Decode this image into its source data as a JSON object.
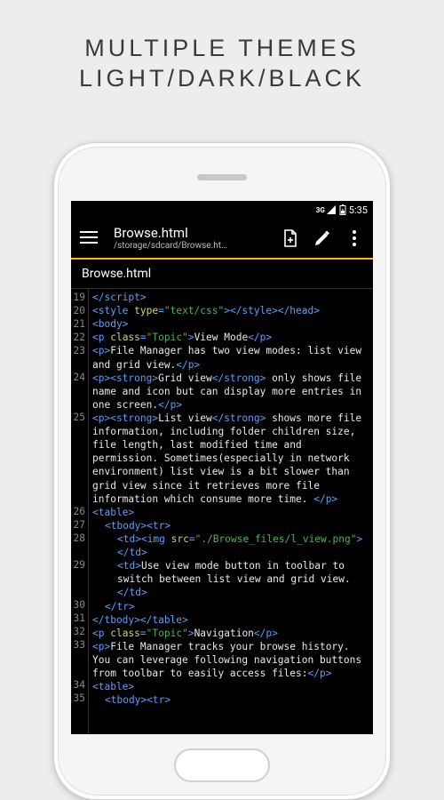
{
  "heading_line1": "MULTIPLE THEMES",
  "heading_line2": "LIGHT/DARK/BLACK",
  "status": {
    "net": "3G",
    "time": "5:35"
  },
  "appbar": {
    "title": "Browse.html",
    "subtitle": "/storage/sdcard/Browse.ht…"
  },
  "tab": "Browse.html",
  "lines": [
    {
      "n": "19",
      "seg": [
        [
          "tag",
          "</script>"
        ]
      ]
    },
    {
      "n": "20",
      "seg": [
        [
          "tag",
          "<style "
        ],
        [
          "attr",
          "type"
        ],
        [
          "tag",
          "="
        ],
        [
          "str",
          "\"text/css\""
        ],
        [
          "tag",
          "></style></head>"
        ]
      ]
    },
    {
      "n": "21",
      "seg": [
        [
          "tag",
          "<body>"
        ]
      ]
    },
    {
      "n": "22",
      "seg": [
        [
          "tag",
          "<p "
        ],
        [
          "attr",
          "class"
        ],
        [
          "tag",
          "="
        ],
        [
          "str",
          "\"Topic\""
        ],
        [
          "tag",
          ">"
        ],
        [
          "txt",
          "View Mode"
        ],
        [
          "tag",
          "</p>"
        ]
      ]
    },
    {
      "n": "23",
      "seg": [
        [
          "tag",
          "<p>"
        ],
        [
          "txt",
          "File Manager has two view modes: list view and grid view."
        ],
        [
          "tag",
          "</p>"
        ]
      ]
    },
    {
      "n": "24",
      "seg": [
        [
          "tag",
          "<p><strong>"
        ],
        [
          "txt",
          "Grid view"
        ],
        [
          "tag",
          "</strong>"
        ],
        [
          "txt",
          " only shows  file name and icon but can display more entries in one screen."
        ],
        [
          "tag",
          "</p>"
        ]
      ]
    },
    {
      "n": "25",
      "seg": [
        [
          "tag",
          "<p><strong>"
        ],
        [
          "txt",
          "List view"
        ],
        [
          "tag",
          "</strong>"
        ],
        [
          "txt",
          " shows more file information, including folder children size, file length, last modified time and permission. Sometimes(especially in network environment) list view is a bit slower than grid view since it retrieves more file information which consume more time. "
        ],
        [
          "tag",
          "</p>"
        ]
      ]
    },
    {
      "n": "26",
      "seg": [
        [
          "tag",
          "<table>"
        ]
      ]
    },
    {
      "n": "27",
      "indent": 1,
      "seg": [
        [
          "tag",
          "<tbody><tr>"
        ]
      ]
    },
    {
      "n": "28",
      "indent": 2,
      "seg": [
        [
          "tag",
          "<td><img "
        ],
        [
          "attr",
          "src"
        ],
        [
          "tag",
          "="
        ],
        [
          "str",
          "\"./Browse_files/l_view.png\""
        ],
        [
          "tag",
          "></td>"
        ]
      ]
    },
    {
      "n": "29",
      "indent": 2,
      "seg": [
        [
          "tag",
          "<td>"
        ],
        [
          "txt",
          "Use view mode button in toolbar to switch between list view and grid view."
        ],
        [
          "tag",
          "</td>"
        ]
      ]
    },
    {
      "n": "30",
      "indent": 1,
      "seg": [
        [
          "tag",
          "</tr>"
        ]
      ]
    },
    {
      "n": "31",
      "seg": [
        [
          "tag",
          "</tbody></table>"
        ]
      ]
    },
    {
      "n": "32",
      "seg": [
        [
          "tag",
          "<p "
        ],
        [
          "attr",
          "class"
        ],
        [
          "tag",
          "="
        ],
        [
          "str",
          "\"Topic\""
        ],
        [
          "tag",
          ">"
        ],
        [
          "txt",
          "Navigation"
        ],
        [
          "tag",
          "</p>"
        ]
      ]
    },
    {
      "n": "33",
      "seg": [
        [
          "tag",
          "<p>"
        ],
        [
          "txt",
          "File Manager tracks your browse history. You can leverage following navigation buttons from toolbar to easily access files:"
        ],
        [
          "tag",
          "</p>"
        ]
      ]
    },
    {
      "n": "34",
      "seg": [
        [
          "tag",
          "<table>"
        ]
      ]
    },
    {
      "n": "35",
      "indent": 1,
      "seg": [
        [
          "tag",
          "<tbody><tr>"
        ]
      ]
    }
  ]
}
